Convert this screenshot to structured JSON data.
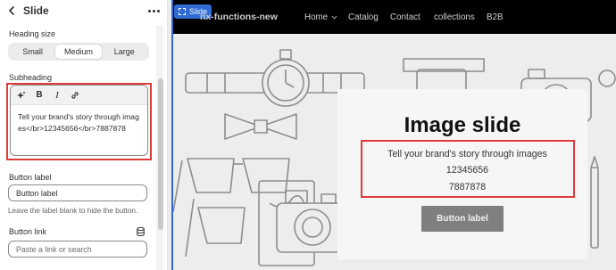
{
  "panel": {
    "title": "Slide",
    "heading_size": {
      "label": "Heading size",
      "options": [
        "Small",
        "Medium",
        "Large"
      ],
      "selected": "Medium"
    },
    "subheading": {
      "label": "Subheading",
      "value": "Tell your brand's story through images</br>12345656</br>7887878"
    },
    "button_label": {
      "label": "Button label",
      "value": "Button label",
      "help": "Leave the label blank to hide the button."
    },
    "button_link": {
      "label": "Button link",
      "placeholder": "Paste a link or search"
    }
  },
  "preview": {
    "badge": "Slide",
    "brand": "nx-functions-new",
    "nav": [
      "Home",
      "Catalog",
      "Contact",
      "collections",
      "B2B"
    ],
    "heading": "Image slide",
    "subheading_lines": [
      "Tell your brand's story through images",
      "12345656",
      "7887878"
    ],
    "button": "Button label"
  },
  "colors": {
    "highlight": "#e03b3b",
    "accent": "#2f6bd3",
    "nav_bg": "#000000",
    "button_bg": "#7f7f7f"
  }
}
